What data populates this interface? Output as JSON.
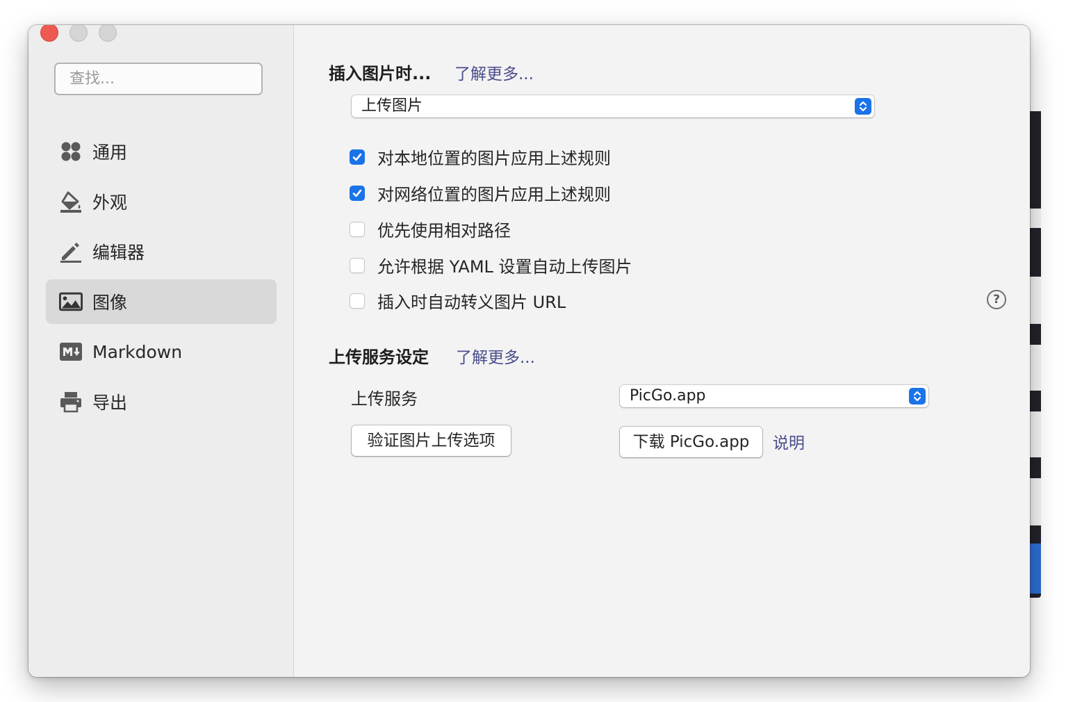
{
  "window": {
    "search": {
      "placeholder": "查找..."
    },
    "sidebar": {
      "items": [
        {
          "label": "通用",
          "icon": "grid-icon",
          "active": false
        },
        {
          "label": "外观",
          "icon": "paint-bucket-icon",
          "active": false
        },
        {
          "label": "编辑器",
          "icon": "pencil-icon",
          "active": false
        },
        {
          "label": "图像",
          "icon": "image-icon",
          "active": true
        },
        {
          "label": "Markdown",
          "icon": "markdown-icon",
          "active": false
        },
        {
          "label": "导出",
          "icon": "printer-icon",
          "active": false
        }
      ]
    },
    "image_section": {
      "title": "插入图片时...",
      "learn_more": "了解更多...",
      "insert_action": "上传图片",
      "options": [
        {
          "label": "对本地位置的图片应用上述规则",
          "checked": true
        },
        {
          "label": "对网络位置的图片应用上述规则",
          "checked": true
        },
        {
          "label": "优先使用相对路径",
          "checked": false
        },
        {
          "label": "允许根据 YAML 设置自动上传图片",
          "checked": false
        },
        {
          "label": "插入时自动转义图片 URL",
          "checked": false
        }
      ],
      "help": "?"
    },
    "upload_section": {
      "title": "上传服务设定",
      "learn_more": "了解更多...",
      "service_label": "上传服务",
      "service_value": "PicGo.app",
      "verify_button": "验证图片上传选项",
      "download_button": "下载 PicGo.app",
      "explain_link": "说明"
    }
  },
  "colors": {
    "accent": "#1a73e8",
    "link": "#4a4c8c",
    "close": "#ee5a52",
    "sidebar_active": "#d9d9da"
  }
}
